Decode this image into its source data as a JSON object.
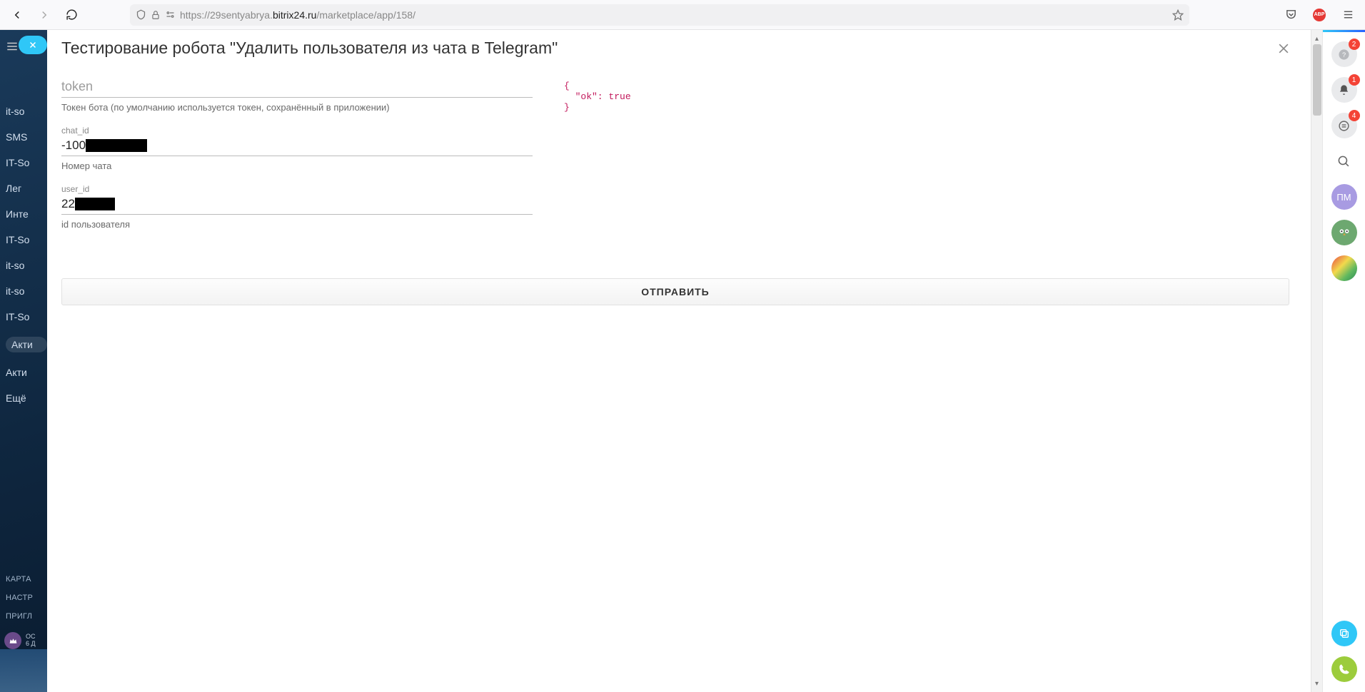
{
  "browser": {
    "url_prefix": "https://29sentyabrya.",
    "url_domain": "bitrix24.ru",
    "url_path": "/marketplace/app/158/"
  },
  "sidebar": {
    "items": [
      {
        "label": "it-so"
      },
      {
        "label": "SMS"
      },
      {
        "label": "IT-So"
      },
      {
        "label": "Лег"
      },
      {
        "label": "Инте"
      },
      {
        "label": "IT-So"
      },
      {
        "label": "it-so"
      },
      {
        "label": "it-so"
      },
      {
        "label": "IT-So"
      },
      {
        "label": "Акти",
        "active": true
      },
      {
        "label": "Акти"
      },
      {
        "label": "Ещё"
      }
    ],
    "lower": [
      {
        "label": "КАРТА"
      },
      {
        "label": "НАСТР"
      },
      {
        "label": "ПРИГЛ"
      }
    ],
    "crown_top": "ОС",
    "crown_bottom": "6 Д"
  },
  "modal": {
    "title": "Тестирование робота \"Удалить пользователя из чата в Telegram\""
  },
  "form": {
    "token": {
      "placeholder": "token",
      "help": "Токен бота (по умолчанию используется токен, сохранённый в приложении)"
    },
    "chat_id": {
      "label": "chat_id",
      "value_visible": "-100",
      "help": "Номер чата"
    },
    "user_id": {
      "label": "user_id",
      "value_visible": "22",
      "help": "id пользователя"
    },
    "submit_label": "ОТПРАВИТЬ"
  },
  "response_json": "{\n  \"ok\": true\n}",
  "rail": {
    "badges": {
      "help": "2",
      "bell": "1",
      "chat": "4"
    },
    "avatar_initials": "ПМ"
  },
  "abp_label": "ABP"
}
